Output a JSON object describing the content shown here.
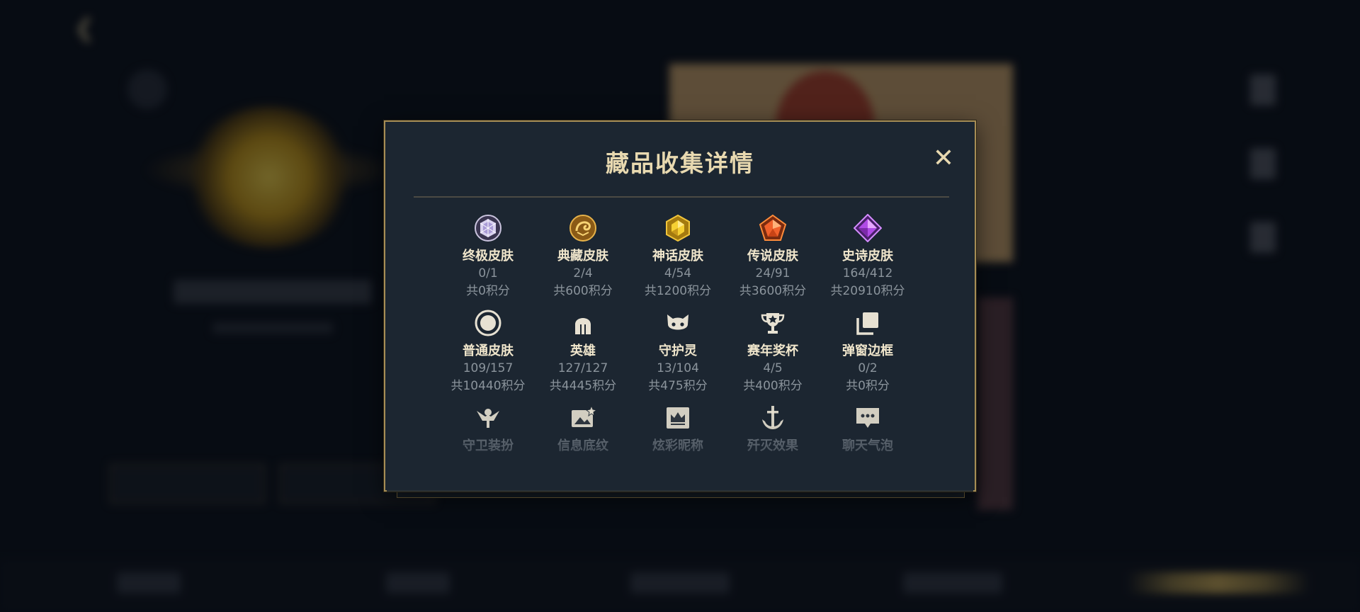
{
  "modal": {
    "title": "藏品收集详情",
    "close_label": "✕"
  },
  "items": [
    {
      "label": "终极皮肤",
      "count": "0/1",
      "points": "共0积分",
      "icon": "ultimate-skin-icon"
    },
    {
      "label": "典藏皮肤",
      "count": "2/4",
      "points": "共600积分",
      "icon": "collector-skin-icon"
    },
    {
      "label": "神话皮肤",
      "count": "4/54",
      "points": "共1200积分",
      "icon": "mythic-skin-icon"
    },
    {
      "label": "传说皮肤",
      "count": "24/91",
      "points": "共3600积分",
      "icon": "legendary-skin-icon"
    },
    {
      "label": "史诗皮肤",
      "count": "164/412",
      "points": "共20910积分",
      "icon": "epic-skin-icon"
    },
    {
      "label": "普通皮肤",
      "count": "109/157",
      "points": "共10440积分",
      "icon": "normal-skin-icon"
    },
    {
      "label": "英雄",
      "count": "127/127",
      "points": "共4445积分",
      "icon": "hero-helmet-icon"
    },
    {
      "label": "守护灵",
      "count": "13/104",
      "points": "共475积分",
      "icon": "guardian-spirit-icon"
    },
    {
      "label": "赛年奖杯",
      "count": "4/5",
      "points": "共400积分",
      "icon": "trophy-icon"
    },
    {
      "label": "弹窗边框",
      "count": "0/2",
      "points": "共0积分",
      "icon": "popup-frame-icon"
    },
    {
      "label": "守卫装扮",
      "icon": "ward-skin-icon"
    },
    {
      "label": "信息底纹",
      "icon": "info-banner-icon"
    },
    {
      "label": "炫彩昵称",
      "icon": "colorful-nickname-icon"
    },
    {
      "label": "歼灭效果",
      "icon": "annihilation-effect-icon"
    },
    {
      "label": "聊天气泡",
      "icon": "chat-bubble-icon"
    }
  ],
  "colors": {
    "modal_bg": "#1c2631",
    "modal_border": "#a68d55",
    "title": "#e8d9b0",
    "label": "#f0e6cc",
    "muted": "#8b949c"
  }
}
